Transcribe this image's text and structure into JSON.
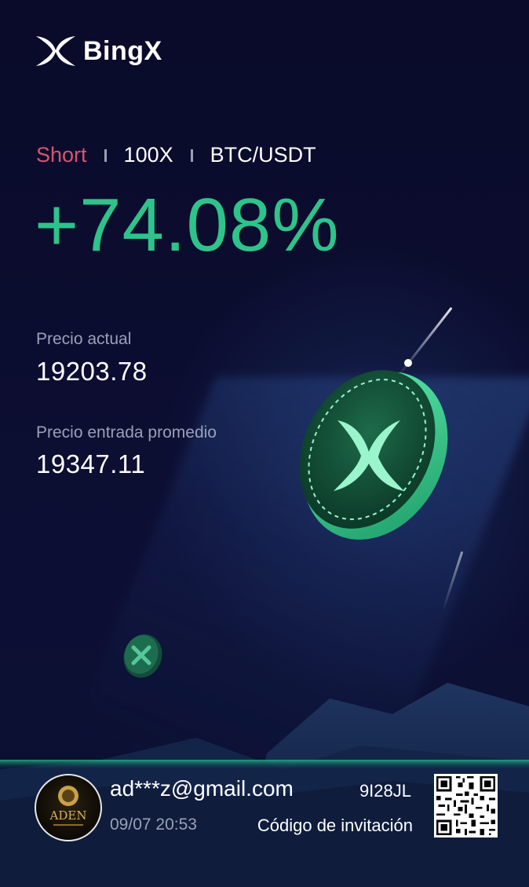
{
  "brand": {
    "name": "BingX",
    "logo_icon": "bingx-x-icon"
  },
  "position": {
    "side": "Short",
    "leverage": "100X",
    "pair": "BTC/USDT",
    "pnl_percent": "+74.08%"
  },
  "prices": {
    "current_label": "Precio actual",
    "current_value": "19203.78",
    "entry_label": "Precio entrada promedio",
    "entry_value": "19347.11"
  },
  "user": {
    "avatar_icon": "aden-capital-avatar-logo",
    "avatar_text": "ADEN",
    "email": "ad***z@gmail.com",
    "datetime": "09/07 20:53"
  },
  "invite": {
    "code": "9I28JL",
    "label": "Código de invitación",
    "qr_icon": "qr-code-icon"
  },
  "colors": {
    "background": "#0a0b2a",
    "short": "#d6566f",
    "profit": "#2ec38a",
    "muted_text": "#9aa0b8"
  }
}
